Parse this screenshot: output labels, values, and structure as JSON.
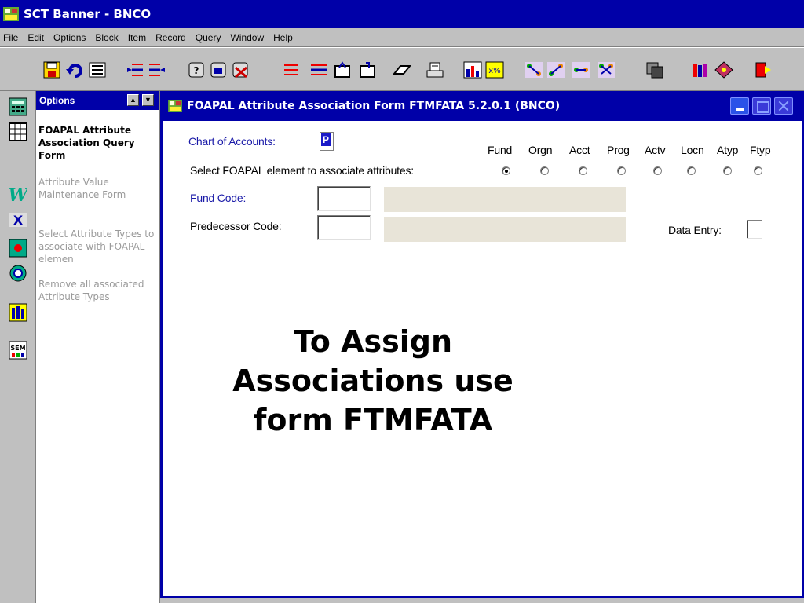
{
  "window": {
    "title": "SCT Banner - BNCO",
    "app_icon": "banner-app-icon"
  },
  "menu": [
    "File",
    "Edit",
    "Options",
    "Block",
    "Item",
    "Record",
    "Query",
    "Window",
    "Help"
  ],
  "toolbar_icons": [
    "save-icon",
    "rollback-icon",
    "exit-icon",
    "previous-block-icon",
    "next-block-icon",
    "enter-query-icon",
    "execute-query-icon",
    "cancel-query-icon",
    "insert-record-icon",
    "remove-record-icon",
    "duplicate-record-icon",
    "next-record-icon",
    "clear-record-icon",
    "print-icon",
    "chart-icon",
    "calculator-icon",
    "tree-icon-1",
    "tree-icon-2",
    "tree-icon-3",
    "tree-icon-4",
    "copy-icon",
    "books-icon",
    "help-icon",
    "exit-door-icon"
  ],
  "sidebar_icons": [
    "calculator-icon",
    "table-icon",
    "workflow-icon",
    "xtender-icon",
    "recall-icon",
    "sync-icon",
    "map-icon",
    "sem-icon"
  ],
  "options": {
    "header": "Options",
    "items": [
      {
        "label": "FOAPAL Attribute Association Query Form",
        "state": "active"
      },
      {
        "label": "Attribute Value Maintenance Form",
        "state": "disabled"
      },
      {
        "label": "Select Attribute Types to associate with FOAPAL elemen",
        "state": "disabled"
      },
      {
        "label": "Remove all associated Attribute Types",
        "state": "disabled"
      }
    ]
  },
  "form": {
    "title": "FOAPAL Attribute Association Form  FTMFATA  5.2.0.1  (BNCO)",
    "chart_of_accounts_label": "Chart of Accounts:",
    "chart_of_accounts_value": "P",
    "select_label": "Select FOAPAL element to associate attributes:",
    "elements": [
      {
        "label": "Fund",
        "selected": true
      },
      {
        "label": "Orgn",
        "selected": false
      },
      {
        "label": "Acct",
        "selected": false
      },
      {
        "label": "Prog",
        "selected": false
      },
      {
        "label": "Actv",
        "selected": false
      },
      {
        "label": "Locn",
        "selected": false
      },
      {
        "label": "Atyp",
        "selected": false
      },
      {
        "label": "Ftyp",
        "selected": false
      }
    ],
    "fund_code_label": "Fund Code:",
    "fund_code_value": "",
    "predecessor_code_label": "Predecessor Code:",
    "predecessor_code_value": "",
    "data_entry_label": "Data Entry:"
  },
  "overlay_text": "To Assign Associations use form FTMFATA",
  "colors": {
    "title_bar": "#0000a8",
    "chrome": "#c0c0c0",
    "label_blue": "#1a1aa8",
    "description_field": "#e8e4d8"
  }
}
